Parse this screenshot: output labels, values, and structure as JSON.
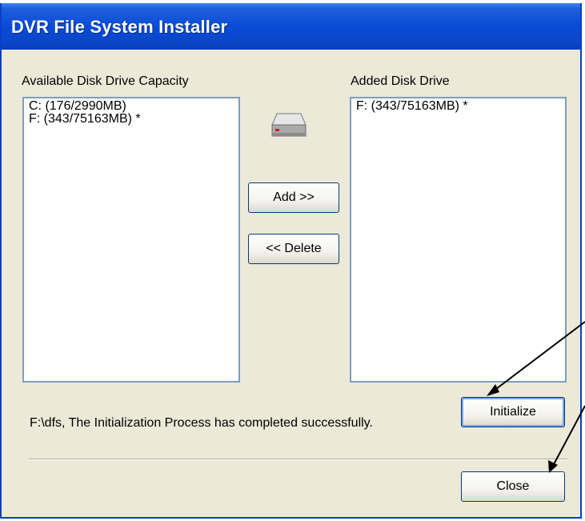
{
  "window": {
    "title": "DVR File System Installer"
  },
  "available": {
    "label": "Available Disk Drive Capacity",
    "items": [
      "C:  (176/2990MB)",
      "F:  (343/75163MB) *"
    ]
  },
  "added": {
    "label": "Added Disk Drive",
    "items": [
      "F:  (343/75163MB) *"
    ]
  },
  "buttons": {
    "add": "Add >>",
    "delete": "<< Delete",
    "initialize": "Initialize",
    "close": "Close"
  },
  "status": {
    "message": "F:\\dfs, The Initialization Process has completed successfully."
  },
  "icons": {
    "drive": "hard-drive-icon"
  }
}
